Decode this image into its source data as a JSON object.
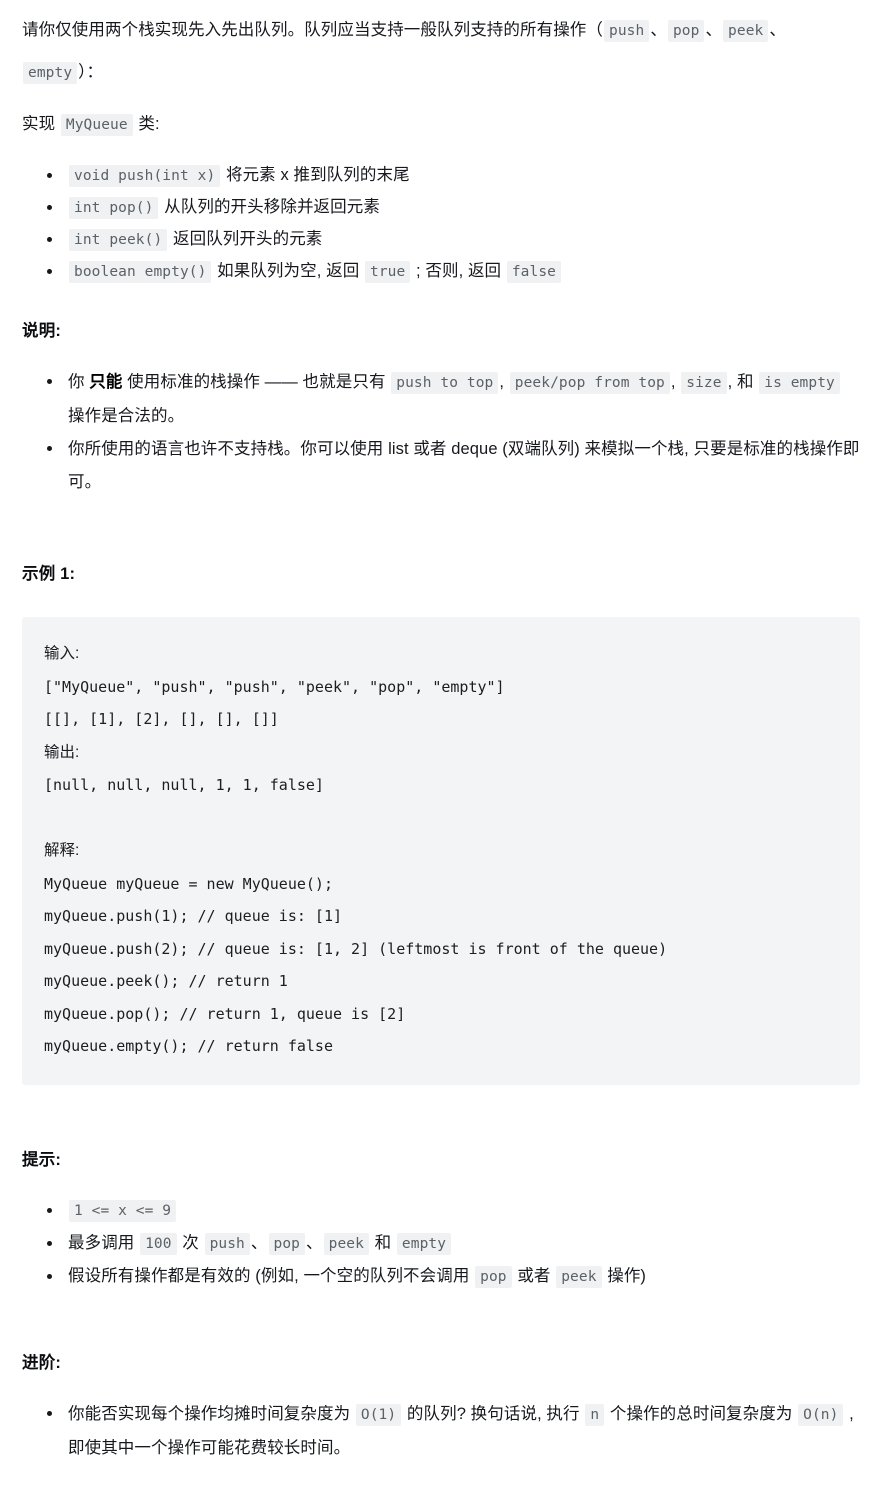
{
  "document": {
    "intro": {
      "before_paren": "请你仅使用两个栈实现先入先出队列。队列应当支持一般队列支持的所有操作（",
      "ops": [
        "push",
        "pop",
        "peek",
        "empty"
      ],
      "separator": "、",
      "after_paren": "）：",
      "implement_prefix": "实现 ",
      "class_name": "MyQueue",
      "implement_suffix": " 类:"
    },
    "api_list": [
      {
        "code": "void push(int x)",
        "text": " 将元素 x 推到队列的末尾"
      },
      {
        "code": "int pop()",
        "text": " 从队列的开头移除并返回元素"
      },
      {
        "code": "int peek()",
        "text": " 返回队列开头的元素"
      },
      {
        "code": "boolean empty()",
        "text_1": " 如果队列为空, 返回 ",
        "true_code": "true",
        "text_2": " ; 否则, 返回 ",
        "false_code": "false"
      }
    ],
    "notes": {
      "title": "说明:",
      "item1": {
        "p1": "你 ",
        "bold": "只能",
        "p2": " 使用标准的栈操作 —— 也就是只有 ",
        "c1": "push to top",
        "p3": ", ",
        "c2": "peek/pop from top",
        "p4": ", ",
        "c3": "size",
        "p5": ", 和 ",
        "c4": "is empty",
        "p6": " 操作是合法的。"
      },
      "item2": "你所使用的语言也许不支持栈。你可以使用 list 或者 deque (双端队列) 来模拟一个栈, 只要是标准的栈操作即可。"
    },
    "example": {
      "title": "示例 1:",
      "input_label": "输入:",
      "input_lines": [
        "[\"MyQueue\", \"push\", \"push\", \"peek\", \"pop\", \"empty\"]",
        "[[], [1], [2], [], [], []]"
      ],
      "output_label": "输出:",
      "output_lines": [
        "[null, null, null, 1, 1, false]"
      ],
      "explain_label": "解释:",
      "explain_lines": [
        "MyQueue myQueue = new MyQueue();",
        "myQueue.push(1); // queue is: [1]",
        "myQueue.push(2); // queue is: [1, 2] (leftmost is front of the queue)",
        "myQueue.peek(); // return 1",
        "myQueue.pop(); // return 1, queue is [2]",
        "myQueue.empty(); // return false"
      ]
    },
    "hints": {
      "title": "提示:",
      "item1_code": "1 <= x <= 9",
      "item2": {
        "p1": "最多调用 ",
        "c1": "100",
        "p2": " 次 ",
        "c2": "push",
        "p3": "、",
        "c3": "pop",
        "p4": "、",
        "c4": "peek",
        "p5": " 和 ",
        "c5": "empty"
      },
      "item3": {
        "p1": "假设所有操作都是有效的 (例如, 一个空的队列不会调用 ",
        "c1": "pop",
        "p2": " 或者 ",
        "c2": "peek",
        "p3": " 操作)"
      }
    },
    "advanced": {
      "title": "进阶:",
      "item1": {
        "p1": "你能否实现每个操作均摊时间复杂度为 ",
        "c1": "O(1)",
        "p2": " 的队列? 换句话说, 执行 ",
        "c2": "n",
        "p3": " 个操作的总时间复杂度为 ",
        "c3": "O(n)",
        "p4": " , 即使其中一个操作可能花费较长时间。"
      }
    }
  },
  "colors": {
    "code_block_bg": "#f3f4f6",
    "chip_bg": "#f0f1f2",
    "chip_text": "#5b6168",
    "body_text": "#16181d"
  }
}
